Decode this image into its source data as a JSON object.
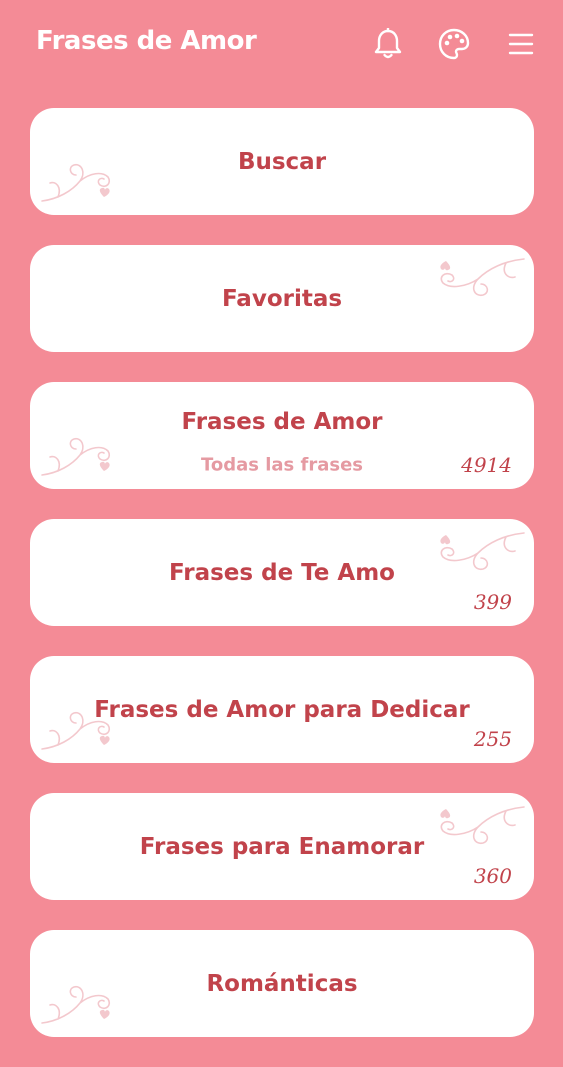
{
  "header": {
    "title": "Frases de Amor",
    "icons": [
      "bell-icon",
      "palette-icon",
      "menu-icon"
    ]
  },
  "colors": {
    "background": "#f48b96",
    "card": "#ffffff",
    "accent": "#c1434b",
    "subtitle": "#e59aa2"
  },
  "cards": [
    {
      "title": "Buscar",
      "subtitle": "",
      "count": ""
    },
    {
      "title": "Favoritas",
      "subtitle": "",
      "count": ""
    },
    {
      "title": "Frases de Amor",
      "subtitle": "Todas las frases",
      "count": "4914"
    },
    {
      "title": "Frases de Te Amo",
      "subtitle": "",
      "count": "399"
    },
    {
      "title": "Frases de Amor para Dedicar",
      "subtitle": "",
      "count": "255"
    },
    {
      "title": "Frases para Enamorar",
      "subtitle": "",
      "count": "360"
    },
    {
      "title": "Románticas",
      "subtitle": "",
      "count": ""
    }
  ]
}
